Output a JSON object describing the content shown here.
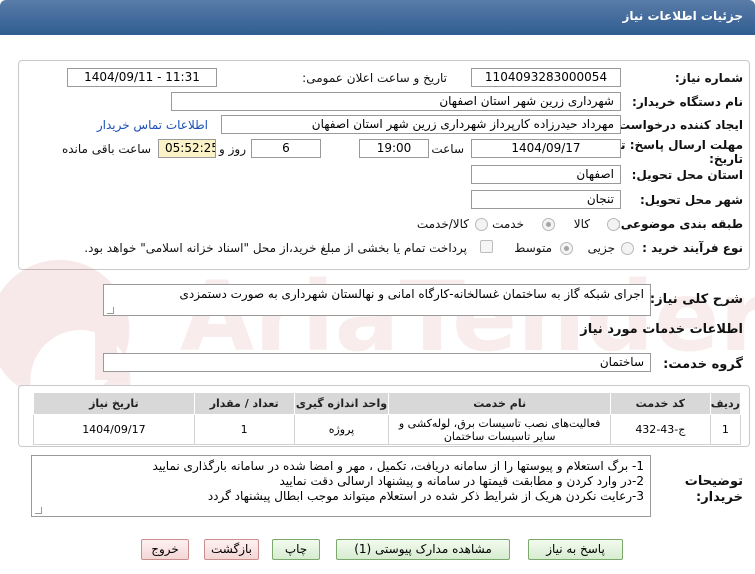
{
  "header": {
    "title": "جزئیات اطلاعات نیاز"
  },
  "fields": {
    "need_number": {
      "label": "شماره نیاز:",
      "value": "1104093283000054"
    },
    "announce_datetime": {
      "label": "تاریخ و ساعت اعلان عمومی:",
      "value": "1404/09/11 - 11:31"
    },
    "buyer_org": {
      "label": "نام دستگاه خریدار:",
      "value": "شهرداری زرین شهر استان اصفهان"
    },
    "requester": {
      "label": "ایجاد کننده درخواست:",
      "value": "مهرداد حیدرزاده کارپرداز شهرداری زرین شهر استان اصفهان",
      "contact_link": "اطلاعات تماس خریدار"
    },
    "deadline": {
      "label_line1": "مهلت ارسال پاسخ: تا",
      "label_line2": "تاریخ:",
      "date": "1404/09/17",
      "time_label": "ساعت",
      "time": "19:00",
      "days": "6",
      "days_label": "روز و",
      "remaining": "05:52:25",
      "remaining_label": "ساعت باقی مانده"
    },
    "delivery_province": {
      "label": "استان محل تحویل:",
      "value": "اصفهان"
    },
    "delivery_city": {
      "label": "شهر محل تحویل:",
      "value": "تنجان"
    },
    "category": {
      "label": "طبقه بندی موضوعی:",
      "options": [
        "کالا",
        "خدمت",
        "کالا/خدمت"
      ],
      "selected": "خدمت"
    },
    "process_type": {
      "label": "نوع فرآیند خرید :",
      "options": [
        "جزیی",
        "متوسط"
      ],
      "selected": "متوسط",
      "treasury_note": "پرداخت تمام یا بخشی از مبلغ خرید،از محل \"اسناد خزانه اسلامی\" خواهد بود."
    }
  },
  "description": {
    "label": "شرح کلی نیاز:",
    "value": "اجرای شبکه گاز به ساختمان غسالخانه-کارگاه امانی و نهالستان شهرداری به صورت دستمزدی"
  },
  "services": {
    "section_title": "اطلاعات خدمات مورد نیاز",
    "group_label": "گروه خدمت:",
    "group_value": "ساختمان",
    "columns": [
      "ردیف",
      "کد خدمت",
      "نام خدمت",
      "واحد اندازه گیری",
      "تعداد / مقدار",
      "تاریخ نیاز"
    ],
    "rows": [
      {
        "row": "1",
        "code": "ج-43-432",
        "name": "فعالیت‌های نصب تاسیسات برق، لوله‌کشی و سایر تاسیسات ساختمان",
        "unit": "پروژه",
        "qty": "1",
        "date": "1404/09/17"
      }
    ]
  },
  "buyer_notes": {
    "label": "توضیحات خریدار:",
    "lines": [
      "1- برگ استعلام و پیوستها را از سامانه دریافت، تکمیل ، مهر و امضا شده در سامانه بارگذاری نمایید",
      "2-در وارد کردن و مطابقت قیمتها در سامانه و پیشنهاد ارسالی دقت نمایید",
      "3-رعایت نکردن هریک از شرایط  ذکر شده در استعلام میتواند موجب ابطال پیشنهاد گردد"
    ]
  },
  "buttons": {
    "reply": "پاسخ به نیاز",
    "attachments": "مشاهده مدارک پیوستی (1)",
    "print": "چاپ",
    "back": "بازگشت",
    "exit": "خروج"
  },
  "watermark": {
    "text": "AriaTender.net"
  },
  "colors": {
    "header": "#2f5d91",
    "link": "#1a4fb5",
    "remaining_bg": "#fbf3c7",
    "button_green": "#d6ecd0",
    "button_red": "#f4d6d6"
  }
}
